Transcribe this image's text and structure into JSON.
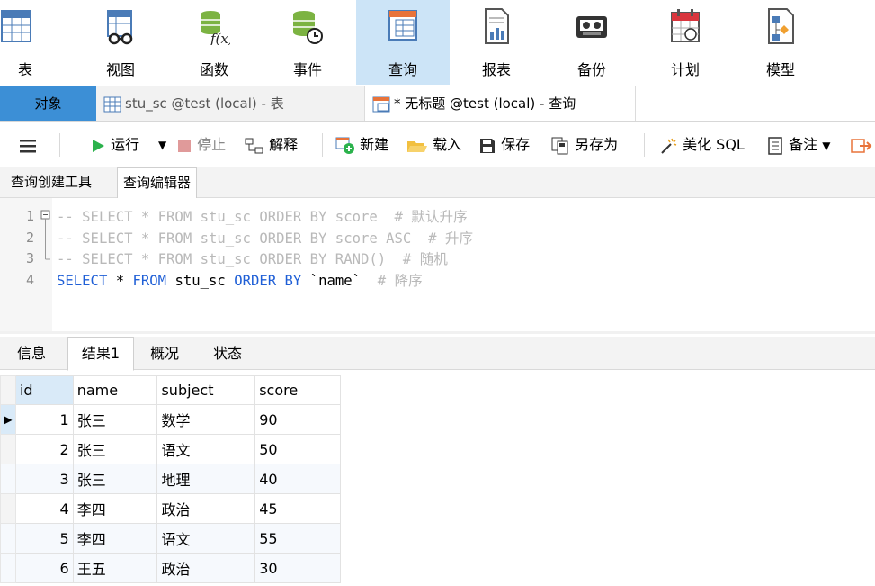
{
  "ribbon": {
    "items": [
      {
        "label": "表",
        "icon": "table-icon"
      },
      {
        "label": "视图",
        "icon": "view-icon"
      },
      {
        "label": "函数",
        "icon": "function-icon"
      },
      {
        "label": "事件",
        "icon": "event-icon"
      },
      {
        "label": "查询",
        "icon": "query-icon",
        "active": true
      },
      {
        "label": "报表",
        "icon": "report-icon"
      },
      {
        "label": "备份",
        "icon": "backup-icon"
      },
      {
        "label": "计划",
        "icon": "schedule-icon"
      },
      {
        "label": "模型",
        "icon": "model-icon"
      }
    ]
  },
  "tabs": {
    "objects": "对象",
    "table_tab": "stu_sc @test (local) - 表",
    "query_tab": "* 无标题 @test (local) - 查询"
  },
  "toolbar": {
    "run": "运行",
    "stop": "停止",
    "explain": "解释",
    "new": "新建",
    "load": "载入",
    "save": "保存",
    "save_as": "另存为",
    "beautify": "美化 SQL",
    "note": "备注"
  },
  "subtabs": {
    "builder": "查询创建工具",
    "editor": "查询编辑器"
  },
  "editor": {
    "line_numbers": [
      "1",
      "2",
      "3",
      "4"
    ],
    "lines": {
      "l1": "-- SELECT * FROM stu_sc ORDER BY score  # 默认升序",
      "l2": "-- SELECT * FROM stu_sc ORDER BY score ASC  # 升序",
      "l3": "-- SELECT * FROM stu_sc ORDER BY RAND()  # 随机",
      "l4_select": "SELECT",
      "l4_star": " * ",
      "l4_from": "FROM",
      "l4_table": " stu_sc ",
      "l4_order": "ORDER BY",
      "l4_col": " `name` ",
      "l4_cmt": " # 降序"
    }
  },
  "result_tabs": {
    "info": "信息",
    "result1": "结果1",
    "overview": "概况",
    "status": "状态"
  },
  "grid": {
    "columns": [
      "id",
      "name",
      "subject",
      "score"
    ],
    "rows": [
      [
        "1",
        "张三",
        "数学",
        "90"
      ],
      [
        "2",
        "张三",
        "语文",
        "50"
      ],
      [
        "3",
        "张三",
        "地理",
        "40"
      ],
      [
        "4",
        "李四",
        "政治",
        "45"
      ],
      [
        "5",
        "李四",
        "语文",
        "55"
      ],
      [
        "6",
        "王五",
        "政治",
        "30"
      ]
    ],
    "current_row_marker": "▶"
  },
  "colors": {
    "active_ribbon": "#cce4f7",
    "objects_tab": "#3c8fd6",
    "keyword": "#1f5fd6",
    "comment": "#b9b9b9",
    "run_green": "#2bb24c",
    "stop_red": "#e09a9a"
  }
}
